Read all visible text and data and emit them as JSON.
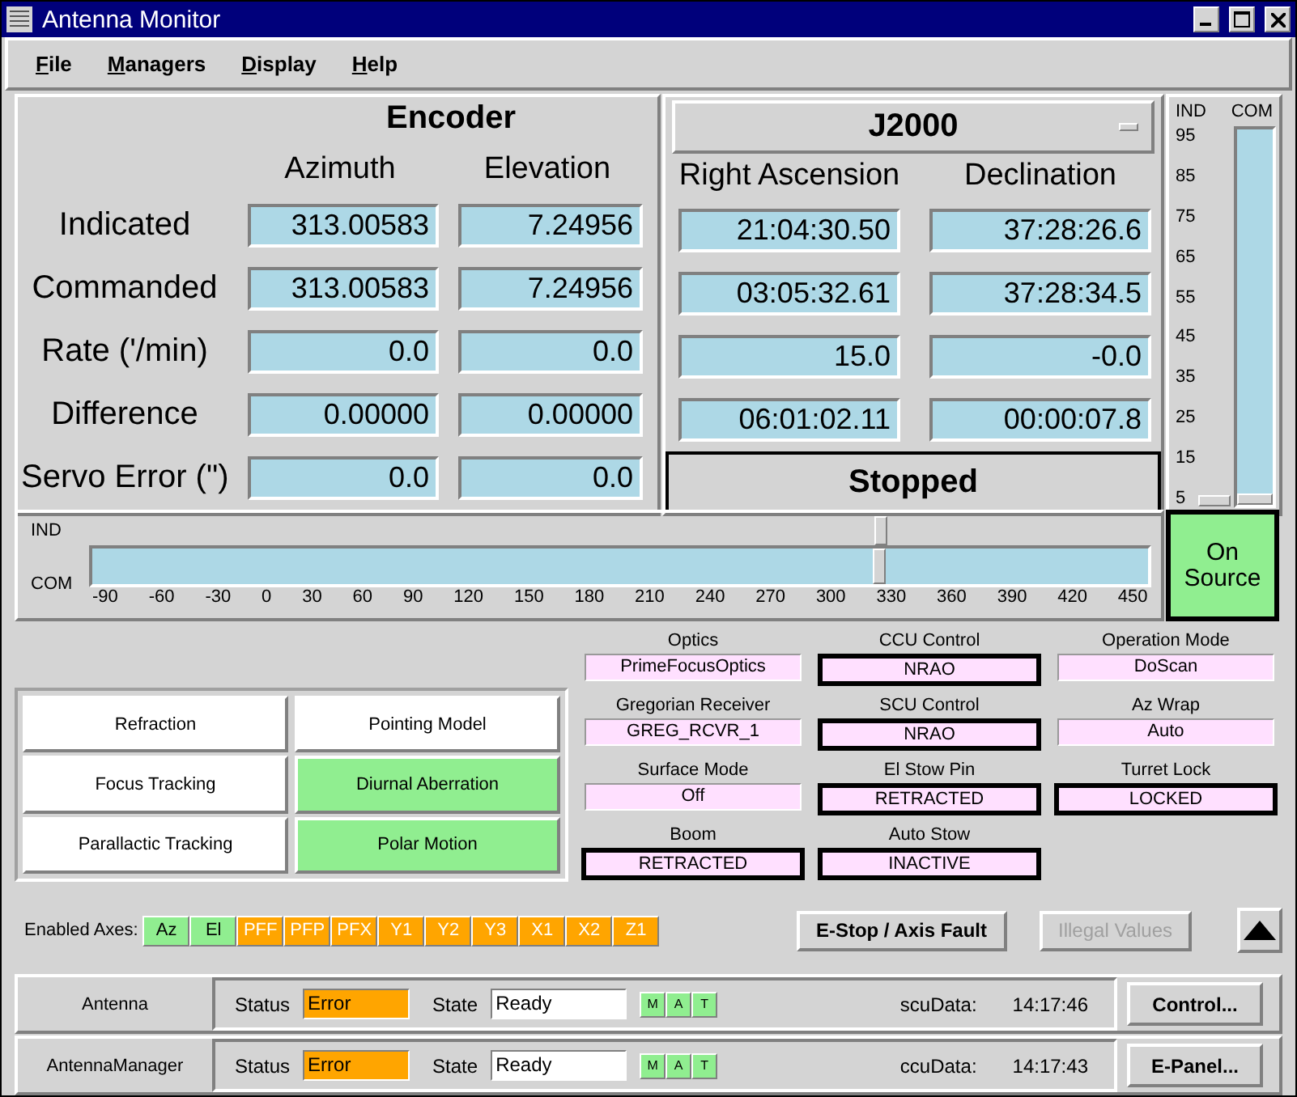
{
  "window": {
    "title": "Antenna Monitor"
  },
  "menu": [
    "File",
    "Managers",
    "Display",
    "Help"
  ],
  "encoder": {
    "title": "Encoder",
    "columns": [
      "Azimuth",
      "Elevation"
    ],
    "rows": [
      {
        "label": "Indicated",
        "values": [
          "313.00583",
          "7.24956"
        ]
      },
      {
        "label": "Commanded",
        "values": [
          "313.00583",
          "7.24956"
        ]
      },
      {
        "label": "Rate ('/min)",
        "values": [
          "0.0",
          "0.0"
        ]
      },
      {
        "label": "Difference",
        "values": [
          "0.00000",
          "0.00000"
        ]
      },
      {
        "label": "Servo Error (\")",
        "values": [
          "0.0",
          "0.0"
        ]
      }
    ]
  },
  "coordinates": {
    "frame": "J2000",
    "columns": [
      "Right Ascension",
      "Declination"
    ],
    "rows": [
      [
        "21:04:30.50",
        "37:28:26.6"
      ],
      [
        "03:05:32.61",
        "37:28:34.5"
      ],
      [
        "15.0",
        "-0.0"
      ],
      [
        "06:01:02.11",
        "00:00:07.8"
      ]
    ],
    "status": "Stopped"
  },
  "elevation_meter": {
    "labels": [
      "IND",
      "COM"
    ],
    "ticks": [
      "95",
      "85",
      "75",
      "65",
      "55",
      "45",
      "35",
      "25",
      "15",
      "5"
    ],
    "ind": {
      "level": 0.0
    },
    "com": {
      "level": 0.0
    }
  },
  "azimuth_slider": {
    "labels": [
      "IND",
      "COM"
    ],
    "ticks": [
      "-90",
      "-60",
      "-30",
      "0",
      "30",
      "60",
      "90",
      "120",
      "150",
      "180",
      "210",
      "240",
      "270",
      "300",
      "330",
      "360",
      "390",
      "420",
      "450"
    ],
    "ind": {
      "level": 0.746
    },
    "com": {
      "level": 0.746
    }
  },
  "on_source": {
    "label": "On Source",
    "active": true
  },
  "corrections": [
    {
      "label": "Refraction",
      "on": false
    },
    {
      "label": "Pointing Model",
      "on": false
    },
    {
      "label": "Focus Tracking",
      "on": false
    },
    {
      "label": "Diurnal Aberration",
      "on": true
    },
    {
      "label": "Parallactic Tracking",
      "on": false
    },
    {
      "label": "Polar Motion",
      "on": true
    }
  ],
  "status_fields": [
    {
      "label": "Optics",
      "value": "PrimeFocusOptics",
      "highlighted": false
    },
    {
      "label": "CCU Control",
      "value": "NRAO",
      "highlighted": true
    },
    {
      "label": "Operation Mode",
      "value": "DoScan",
      "highlighted": false
    },
    {
      "label": "Gregorian Receiver",
      "value": "GREG_RCVR_1",
      "highlighted": false
    },
    {
      "label": "SCU Control",
      "value": "NRAO",
      "highlighted": true
    },
    {
      "label": "Az Wrap",
      "value": "Auto",
      "highlighted": false
    },
    {
      "label": "Surface Mode",
      "value": "Off",
      "highlighted": false
    },
    {
      "label": "El Stow Pin",
      "value": "RETRACTED",
      "highlighted": true
    },
    {
      "label": "Turret Lock",
      "value": "LOCKED",
      "highlighted": true
    },
    {
      "label": "Boom",
      "value": "RETRACTED",
      "highlighted": true
    },
    {
      "label": "Auto Stow",
      "value": "INACTIVE",
      "highlighted": true
    }
  ],
  "axes": {
    "label": "Enabled Axes:",
    "items": [
      {
        "label": "Az",
        "enabled": true
      },
      {
        "label": "El",
        "enabled": true
      },
      {
        "label": "PFF",
        "enabled": false
      },
      {
        "label": "PFP",
        "enabled": false
      },
      {
        "label": "PFX",
        "enabled": false
      },
      {
        "label": "Y1",
        "enabled": false
      },
      {
        "label": "Y2",
        "enabled": false
      },
      {
        "label": "Y3",
        "enabled": false
      },
      {
        "label": "X1",
        "enabled": false
      },
      {
        "label": "X2",
        "enabled": false
      },
      {
        "label": "Z1",
        "enabled": false
      }
    ]
  },
  "buttons": [
    {
      "label": "E-Stop / Axis Fault",
      "disabled": false
    },
    {
      "label": "Illegal Values",
      "disabled": true
    }
  ],
  "managers": [
    {
      "name": "Antenna",
      "status_label": "Status",
      "status": "Error",
      "state_label": "State",
      "state": "Ready",
      "flags": [
        {
          "label": "M",
          "on": true
        },
        {
          "label": "A",
          "on": true
        },
        {
          "label": "T",
          "on": true
        }
      ],
      "data_label": "scuData:",
      "time": "14:17:46",
      "button": "Control..."
    },
    {
      "name": "AntennaManager",
      "status_label": "Status",
      "status": "Error",
      "state_label": "State",
      "state": "Ready",
      "flags": [
        {
          "label": "M",
          "on": true
        },
        {
          "label": "A",
          "on": true
        },
        {
          "label": "T",
          "on": true
        }
      ],
      "data_label": "ccuData:",
      "time": "14:17:43",
      "button": "E-Panel..."
    }
  ]
}
